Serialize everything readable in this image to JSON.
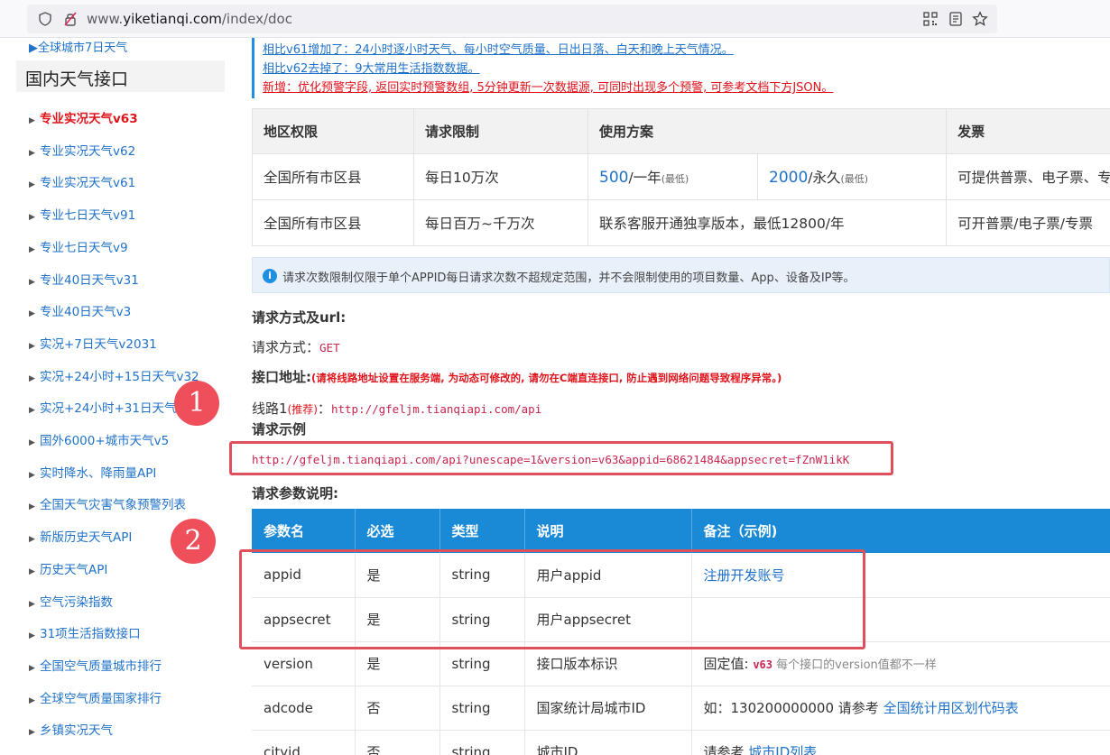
{
  "browser": {
    "url_prefix": "www.",
    "url_domain": "yiketianqi.com",
    "url_path": "/index/doc"
  },
  "sidebar": {
    "top_item": "全球城市7日天气",
    "heading": "国内天气接口",
    "items": [
      {
        "label": "专业实况天气v63",
        "active": true
      },
      {
        "label": "专业实况天气v62"
      },
      {
        "label": "专业实况天气v61"
      },
      {
        "label": "专业七日天气v91"
      },
      {
        "label": "专业七日天气v9"
      },
      {
        "label": "专业40日天气v31"
      },
      {
        "label": "专业40日天气v3"
      },
      {
        "label": "实况+7日天气v2031"
      },
      {
        "label": "实况+24小时+15日天气v32"
      },
      {
        "label": "实况+24小时+31日天气"
      },
      {
        "label": "国外6000+城市天气v5"
      },
      {
        "label": "实时降水、降雨量API"
      },
      {
        "label": "全国天气灾害气象预警列表"
      },
      {
        "label": "新版历史天气API"
      },
      {
        "label": "历史天气API"
      },
      {
        "label": "空气污染指数"
      },
      {
        "label": "31项生活指数接口"
      },
      {
        "label": "全国空气质量城市排行"
      },
      {
        "label": "全球空气质量国家排行"
      },
      {
        "label": "乡镇实况天气"
      }
    ]
  },
  "notices": [
    {
      "text": "相比v61增加了：24小时逐小时天气、每小时空气质量、日出日落、白天和晚上天气情况。",
      "color": "#1f72c8"
    },
    {
      "text": "相比v62去掉了：9大常用生活指数数据。",
      "color": "#1f72c8"
    },
    {
      "text": "新增：优化预警字段, 返回实时预警数组, 5分钟更新一次数据源, 可同时出现多个预警, 可参考文档下方JSON。",
      "color": "#e0131b"
    }
  ],
  "plan_table": {
    "headers": [
      "地区权限",
      "请求限制",
      "使用方案",
      "发票"
    ],
    "row1": {
      "region": "全国所有市区县",
      "limit": "每日10万次",
      "plan_a_num": "500",
      "plan_a_unit": "/一年",
      "plan_a_note": "(最低)",
      "plan_b_num": "2000",
      "plan_b_unit": "/永久",
      "plan_b_note": "(最低)",
      "invoice": "可提供普票、电子票、专"
    },
    "row2": {
      "region": "全国所有市区县",
      "limit": "每日百万~千万次",
      "plan": "联系客服开通独享版本，最低12800/年",
      "invoice": "可开普票/电子票/专票"
    }
  },
  "info_text": "请求次数限制仅限于单个APPID每日请求次数不超规定范围，并不会限制使用的项目数量、App、设备及IP等。",
  "request": {
    "method_title": "请求方式及url:",
    "method_label": "请求方式：",
    "method_value": "GET",
    "address_label": "接口地址:",
    "address_warning": "(请将线路地址设置在服务端, 为动态可修改的, 请勿在C端直连接口, 防止遇到网络问题导致程序异常。)",
    "line_label": "线路1",
    "line_recommend": "(推荐)",
    "line_colon": "：",
    "line_url": "http://gfeljm.tianqiapi.com/api",
    "example_title": "请求示例",
    "example_url": "http://gfeljm.tianqiapi.com/api?unescape=1&version=v63&appid=68621484&appsecret=fZnW1ikK",
    "params_title": "请求参数说明:"
  },
  "params_table": {
    "headers": [
      "参数名",
      "必选",
      "类型",
      "说明",
      "备注（示例)"
    ],
    "rows": [
      {
        "name": "appid",
        "required": "是",
        "type": "string",
        "desc": "用户appid",
        "note_link": "注册开发账号"
      },
      {
        "name": "appsecret",
        "required": "是",
        "type": "string",
        "desc": "用户appsecret"
      },
      {
        "name": "version",
        "required": "是",
        "type": "string",
        "desc": "接口版本标识",
        "note_prefix": "固定值: ",
        "note_code": "v63",
        "note_gray": " 每个接口的version值都不一样"
      },
      {
        "name": "adcode",
        "required": "否",
        "type": "string",
        "desc": "国家统计局城市ID",
        "note_prefix": "如：130200000000 请参考 ",
        "note_link": "全国统计用区划代码表"
      },
      {
        "name": "cityid",
        "required": "否",
        "type": "string",
        "desc": "城市ID",
        "note_prefix": "请参考 ",
        "note_link": "城市ID列表"
      }
    ]
  },
  "badges": [
    "1",
    "2"
  ]
}
